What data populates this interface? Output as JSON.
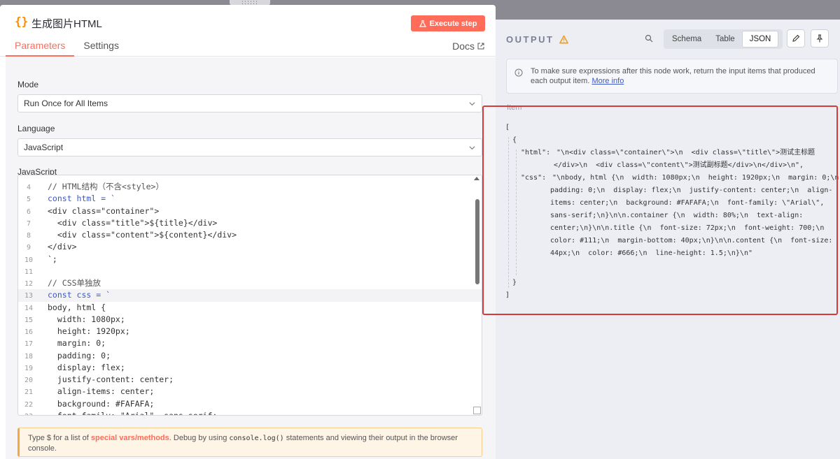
{
  "node": {
    "title": "生成图片HTML",
    "execute_label": "Execute step",
    "tabs": [
      "Parameters",
      "Settings"
    ],
    "docs_label": "Docs"
  },
  "params": {
    "mode_label": "Mode",
    "mode_value": "Run Once for All Items",
    "language_label": "Language",
    "language_value": "JavaScript",
    "code_label": "JavaScript"
  },
  "code": {
    "lines": [
      {
        "n": "4",
        "t": "// HTML结构（不含<style>）"
      },
      {
        "n": "5",
        "t": "const html = `"
      },
      {
        "n": "6",
        "t": "<div class=\"container\">"
      },
      {
        "n": "7",
        "t": "  <div class=\"title\">${title}</div>"
      },
      {
        "n": "8",
        "t": "  <div class=\"content\">${content}</div>"
      },
      {
        "n": "9",
        "t": "</div>"
      },
      {
        "n": "10",
        "t": "`;"
      },
      {
        "n": "11",
        "t": ""
      },
      {
        "n": "12",
        "t": "// CSS单独放"
      },
      {
        "n": "13",
        "t": "const css = `"
      },
      {
        "n": "14",
        "t": "body, html {"
      },
      {
        "n": "15",
        "t": "  width: 1080px;"
      },
      {
        "n": "16",
        "t": "  height: 1920px;"
      },
      {
        "n": "17",
        "t": "  margin: 0;"
      },
      {
        "n": "18",
        "t": "  padding: 0;"
      },
      {
        "n": "19",
        "t": "  display: flex;"
      },
      {
        "n": "20",
        "t": "  justify-content: center;"
      },
      {
        "n": "21",
        "t": "  align-items: center;"
      },
      {
        "n": "22",
        "t": "  background: #FAFAFA;"
      },
      {
        "n": "23",
        "t": "  font-family: \"Arial\", sans-serif;"
      }
    ]
  },
  "hint": {
    "p1": "Type $ for a list of ",
    "hl": "special vars/methods",
    "p2": ". Debug by using ",
    "mono": "console.log()",
    "p3": " statements and viewing their output in the browser console."
  },
  "output": {
    "title": "OUTPUT",
    "views": [
      "Schema",
      "Table",
      "JSON"
    ],
    "active_view": "JSON",
    "notice_text": "To make sure expressions after this node work, return the input items that produced each output item.",
    "notice_link": "More info",
    "item_label": "Item",
    "json": {
      "open_bracket": "[",
      "open_brace": "{",
      "html_key": "\"html\":",
      "html_lines": [
        "\"\\n<div class=\\\"container\\\">\\n  <div class=\\\"title\\\">测试主标题",
        "</div>\\n  <div class=\\\"content\\\">测试副标题</div>\\n</div>\\n\","
      ],
      "css_key": "\"css\":",
      "css_lines": [
        "\"\\nbody, html {\\n  width: 1080px;\\n  height: 1920px;\\n  margin: 0;\\n",
        "padding: 0;\\n  display: flex;\\n  justify-content: center;\\n  align-",
        "items: center;\\n  background: #FAFAFA;\\n  font-family: \\\"Arial\\\",",
        "sans-serif;\\n}\\n\\n.container {\\n  width: 80%;\\n  text-align:",
        "center;\\n}\\n\\n.title {\\n  font-size: 72px;\\n  font-weight: 700;\\n",
        "color: #111;\\n  margin-bottom: 40px;\\n}\\n\\n.content {\\n  font-size:",
        "44px;\\n  color: #666;\\n  line-height: 1.5;\\n}\\n\""
      ],
      "close_brace": "}",
      "close_bracket": "]"
    }
  }
}
